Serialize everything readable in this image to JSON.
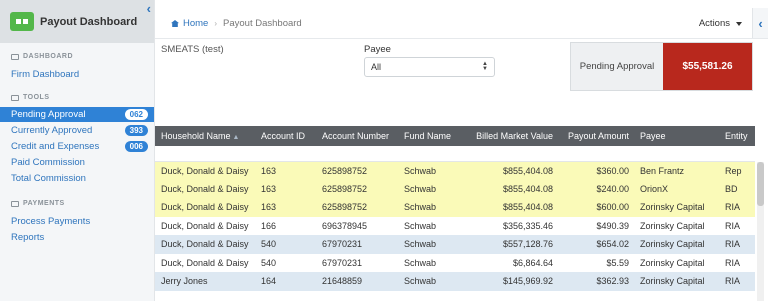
{
  "app": {
    "title": "Payout Dashboard",
    "collapse_icon": "chevron-left-icon"
  },
  "sidebar": {
    "dashboard_section": "DASHBOARD",
    "dashboard_items": [
      {
        "label": "Firm Dashboard"
      }
    ],
    "tools_section": "TOOLS",
    "tools_items": [
      {
        "label": "Pending Approval",
        "badge": "062",
        "active": true
      },
      {
        "label": "Currently Approved",
        "badge": "393"
      },
      {
        "label": "Credit and Expenses",
        "badge": "006"
      },
      {
        "label": "Paid Commission"
      },
      {
        "label": "Total Commission"
      }
    ],
    "payments_section": "PAYMENTS",
    "payments_items": [
      {
        "label": "Process Payments"
      },
      {
        "label": "Reports"
      }
    ]
  },
  "breadcrumb": {
    "home": "Home",
    "current": "Payout Dashboard"
  },
  "actions_label": "Actions",
  "filters": {
    "client": "SMEATS (test)",
    "payee_label": "Payee",
    "payee_value": "All"
  },
  "summary": {
    "label": "Pending Approval",
    "value": "$55,581.26",
    "accent": "#b8281d"
  },
  "table": {
    "columns": [
      "Household Name",
      "Account ID",
      "Account Number",
      "Fund Name",
      "Billed Market Value",
      "Payout Amount",
      "Payee",
      "Entity"
    ],
    "rows": [
      {
        "household": "Duck, Donald & Daisy",
        "account_id": "163",
        "account_number": "625898752",
        "fund": "Schwab",
        "billed": "$855,404.08",
        "payout": "$360.00",
        "payee": "Ben Frantz",
        "entity": "Rep"
      },
      {
        "household": "Duck, Donald & Daisy",
        "account_id": "163",
        "account_number": "625898752",
        "fund": "Schwab",
        "billed": "$855,404.08",
        "payout": "$240.00",
        "payee": "OrionX",
        "entity": "BD"
      },
      {
        "household": "Duck, Donald & Daisy",
        "account_id": "163",
        "account_number": "625898752",
        "fund": "Schwab",
        "billed": "$855,404.08",
        "payout": "$600.00",
        "payee": "Zorinsky Capital",
        "entity": "RIA"
      },
      {
        "household": "Duck, Donald & Daisy",
        "account_id": "166",
        "account_number": "696378945",
        "fund": "Schwab",
        "billed": "$356,335.46",
        "payout": "$490.39",
        "payee": "Zorinsky Capital",
        "entity": "RIA"
      },
      {
        "household": "Duck, Donald & Daisy",
        "account_id": "540",
        "account_number": "67970231",
        "fund": "Schwab",
        "billed": "$557,128.76",
        "payout": "$654.02",
        "payee": "Zorinsky Capital",
        "entity": "RIA"
      },
      {
        "household": "Duck, Donald & Daisy",
        "account_id": "540",
        "account_number": "67970231",
        "fund": "Schwab",
        "billed": "$6,864.64",
        "payout": "$5.59",
        "payee": "Zorinsky Capital",
        "entity": "RIA"
      },
      {
        "household": "Jerry Jones",
        "account_id": "164",
        "account_number": "21648859",
        "fund": "Schwab",
        "billed": "$145,969.92",
        "payout": "$362.93",
        "payee": "Zorinsky Capital",
        "entity": "RIA"
      }
    ]
  }
}
